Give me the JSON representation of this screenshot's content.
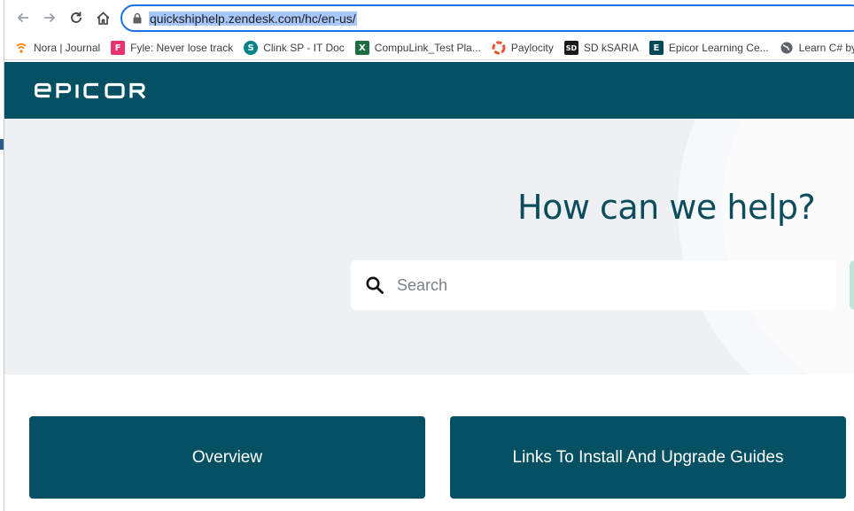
{
  "browser": {
    "url_prefix": "",
    "url": "quickshiphelp.zendesk.com/hc/en-us/",
    "bookmarks": [
      {
        "label": "Nora | Journal",
        "icon": "nora-icon",
        "color": "#f28c28"
      },
      {
        "label": "Fyle: Never lose track",
        "icon": "fyle-icon",
        "color": "#e8336d"
      },
      {
        "label": "Clink SP - IT Doc",
        "icon": "sharepoint-icon",
        "color": "#038387"
      },
      {
        "label": "CompuLink_Test Pla...",
        "icon": "excel-icon",
        "color": "#1d6f42"
      },
      {
        "label": "Paylocity",
        "icon": "paylocity-icon",
        "color": "#e8552d"
      },
      {
        "label": "SD kSARIA",
        "icon": "ksaria-icon",
        "color": "#1b1b1b"
      },
      {
        "label": "Epicor Learning Ce...",
        "icon": "epicor-learning-icon",
        "color": "#00485a"
      },
      {
        "label": "Learn C# by Buildin...",
        "icon": "globe-icon",
        "color": "#5f6368"
      }
    ]
  },
  "site": {
    "logo_text": "EPICOR",
    "brand_color": "#055062",
    "hero_title": "How can we help?",
    "search_placeholder": "Search",
    "cards": [
      {
        "label": "Overview"
      },
      {
        "label": "Links To Install And Upgrade Guides"
      }
    ]
  }
}
